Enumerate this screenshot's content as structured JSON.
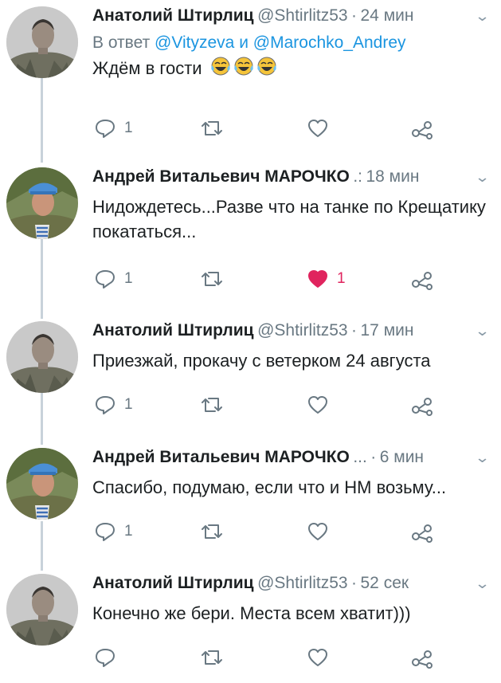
{
  "tweets": [
    {
      "name": "Анатолий Штирлиц",
      "handle": "@Shtirlitz53",
      "dot": "·",
      "time": "24 мин",
      "reply_prefix": "В ответ",
      "reply_user1": "@Vityzeva",
      "reply_and": "и",
      "reply_user2": "@Marochko_Andrey",
      "text": "Ждём в гости",
      "emoji": [
        "face-with-tears-of-joy",
        "face-with-tears-of-joy",
        "face-with-tears-of-joy"
      ],
      "replies": "1",
      "likes": "",
      "liked": false
    },
    {
      "name": "Андрей Витальевич МАРОЧКО",
      "handle": ".:",
      "dot": "",
      "time": "18 мин",
      "text": "Нидождетесь...Разве что на танке по Крещатику покататься...",
      "replies": "1",
      "likes": "1",
      "liked": true
    },
    {
      "name": "Анатолий Штирлиц",
      "handle": "@Shtirlitz53",
      "dot": "·",
      "time": "17 мин",
      "text": "Приезжай, прокачу с ветерком 24 августа",
      "replies": "1",
      "likes": "",
      "liked": false
    },
    {
      "name": "Андрей Витальевич МАРОЧКО",
      "handle": "...",
      "dot": "·",
      "time": "6 мин",
      "text": "Спасибо, подумаю, если что и НМ возьму...",
      "replies": "1",
      "likes": "",
      "liked": false
    },
    {
      "name": "Анатолий Штирлиц",
      "handle": "@Shtirlitz53",
      "dot": "·",
      "time": "52 сек",
      "text": "Конечно же бери. Места всем хватит)))",
      "replies": "",
      "likes": "",
      "liked": false
    }
  ],
  "icons": {
    "reply": "reply-icon",
    "retweet": "retweet-icon",
    "like": "heart-icon",
    "share": "share-icon",
    "menu": "chevron-down-icon"
  },
  "colors": {
    "link": "#1b95e0",
    "secondary_text": "#697882",
    "like_active": "#e0245e",
    "thread_line": "#c8d2da"
  }
}
